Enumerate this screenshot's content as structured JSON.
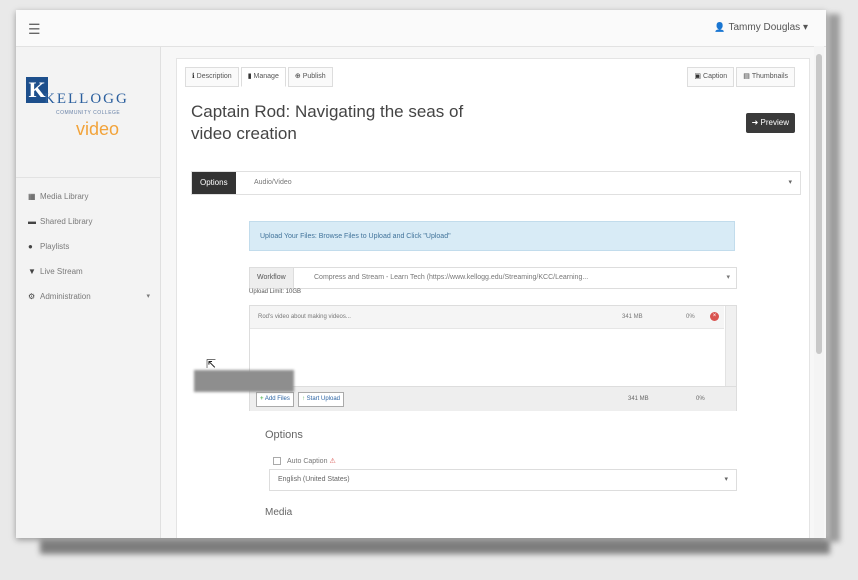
{
  "topbar": {
    "menu_icon": "hamburger-icon",
    "user_icon": "user-icon",
    "user_name": "Tammy Douglas",
    "user_caret": "▾"
  },
  "sidebar": {
    "logo": {
      "mark": "K",
      "name": "KELLOGG",
      "subtitle": "COMMUNITY COLLEGE",
      "product": "video"
    },
    "items": [
      {
        "icon": "grid-icon",
        "label": "Media Library"
      },
      {
        "icon": "folder-icon",
        "label": "Shared Library"
      },
      {
        "icon": "play-icon",
        "label": "Playlists"
      },
      {
        "icon": "broadcast-icon",
        "label": "Live Stream"
      },
      {
        "icon": "settings-icon",
        "label": "Administration",
        "caret": "▾"
      }
    ]
  },
  "main": {
    "tabs": [
      {
        "icon": "info-icon",
        "label": "Description"
      },
      {
        "icon": "file-icon",
        "label": "Manage"
      },
      {
        "icon": "globe-icon",
        "label": "Publish"
      }
    ],
    "right_tabs": [
      {
        "icon": "caption-icon",
        "label": "Caption"
      },
      {
        "icon": "image-icon",
        "label": "Thumbnails"
      }
    ],
    "title": "Captain Rod: Navigating the seas of video creation",
    "preview_label": "Preview",
    "options_button": "Options",
    "section_select": "Audio/Video",
    "info_message": "Upload Your Files: Browse Files to Upload and Click \"Upload\"",
    "runtime_label": "Workflow",
    "runtime_value": "Compress and Stream - Learn Tech (https://www.kellogg.edu/Streaming/KCC/Learning...",
    "upload_limit": "Upload Limit: 10GB",
    "file": {
      "name": "Rod's video about making videos...",
      "size": "341 MB",
      "percent": "0%"
    },
    "add_files_label": "Add Files",
    "start_upload_label": "Start Upload",
    "total_size": "341 MB",
    "total_percent": "0%",
    "options_heading": "Options",
    "auto_caption_label": "Auto Caption",
    "language_value": "English (United States)",
    "media_heading": "Media"
  }
}
